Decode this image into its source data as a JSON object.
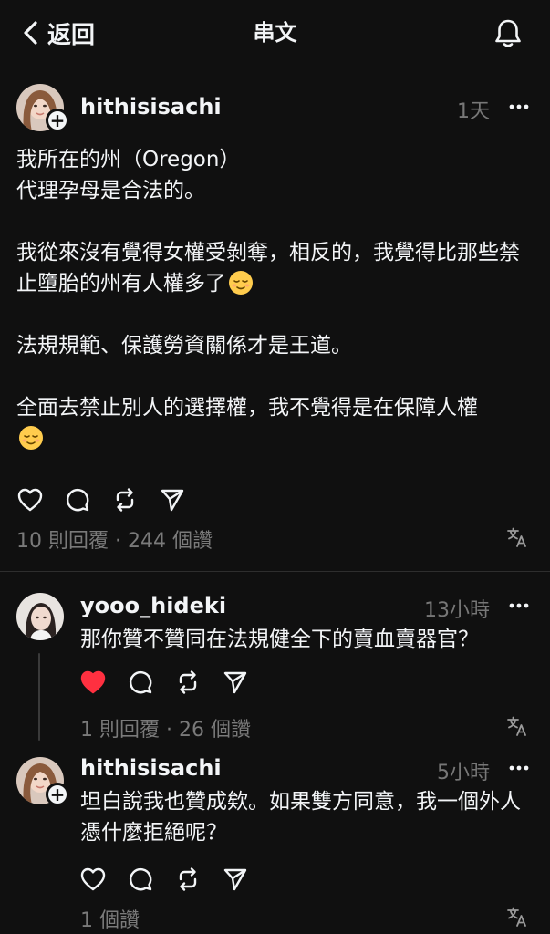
{
  "header": {
    "back_label": "返回",
    "title": "串文"
  },
  "post": {
    "username": "hithisisachi",
    "timestamp": "1天",
    "paragraphs": [
      "我所在的州（Oregon）\n代理孕母是合法的。",
      "我從來沒有覺得女權受剝奪，相反的，我覺得比那些禁止墮胎的州有人權多了",
      "法規規範、保護勞資關係才是王道。",
      "全面去禁止別人的選擇權，我不覺得是在保障人權"
    ],
    "stats": "10 則回覆 · 244 個讚"
  },
  "replies": [
    {
      "username": "yooo_hideki",
      "timestamp": "13小時",
      "text": "那你贊不贊同在法規健全下的賣血賣器官？",
      "liked": true,
      "stats": "1 則回覆 · 26 個讚"
    },
    {
      "username": "hithisisachi",
      "timestamp": "5小時",
      "text": "坦白說我也贊成欸。如果雙方同意，我一個外人憑什麼拒絕呢？",
      "liked": false,
      "stats": "1 個讚"
    }
  ],
  "colors": {
    "background": "#101010",
    "text": "#f3f5f7",
    "muted": "#777777",
    "like_red": "#ff3040"
  },
  "icons": {
    "heart": "heart-icon",
    "comment": "comment-icon",
    "repost": "repost-icon",
    "share": "share-icon",
    "translate": "translate-icon",
    "bell": "bell-icon",
    "more": "more-icon"
  }
}
